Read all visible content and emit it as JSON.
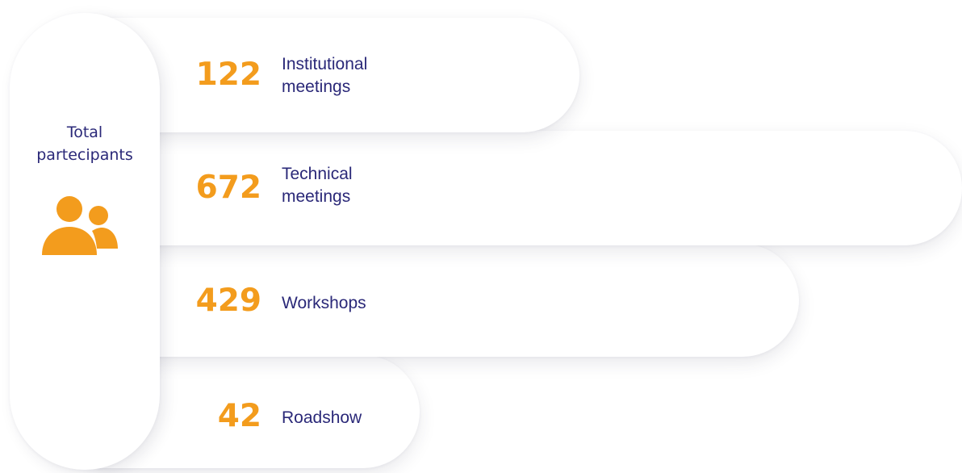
{
  "total": {
    "label": "Total\npartecipants",
    "icon": "people-icon",
    "icon_color": "#f39c1d"
  },
  "items": [
    {
      "value": "122",
      "label": "Institutional\nmeetings"
    },
    {
      "value": "672",
      "label": "Technical\nmeetings"
    },
    {
      "value": "429",
      "label": "Workshops"
    },
    {
      "value": "42",
      "label": "Roadshow"
    }
  ],
  "colors": {
    "accent": "#f39c1d",
    "text": "#2a2878",
    "card": "#ffffff"
  }
}
